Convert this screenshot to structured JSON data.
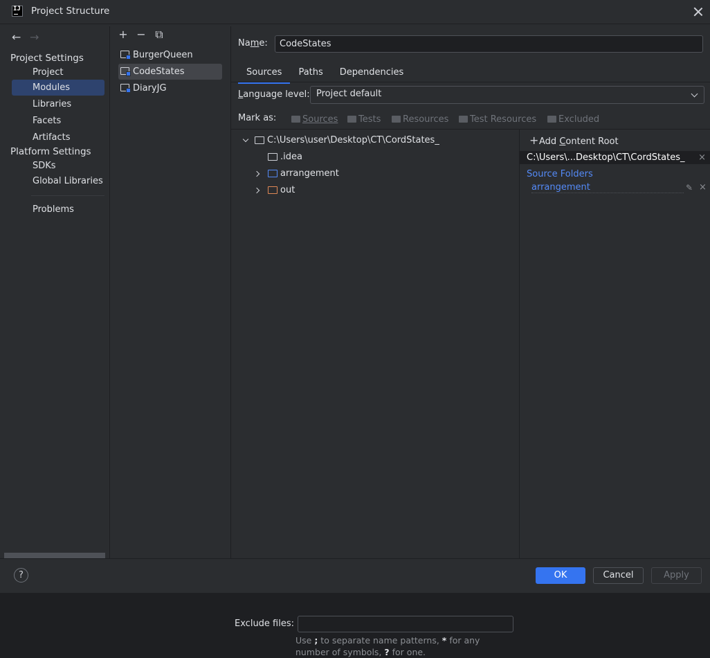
{
  "window": {
    "title": "Project Structure"
  },
  "nav": {
    "back_icon": "arrow-left-icon",
    "forward_icon": "arrow-right-icon",
    "project_settings_header": "Project Settings",
    "platform_settings_header": "Platform Settings",
    "project_items": [
      "Project",
      "Modules",
      "Libraries",
      "Facets",
      "Artifacts"
    ],
    "platform_items": [
      "SDKs",
      "Global Libraries"
    ],
    "problems": "Problems",
    "selected": "Modules"
  },
  "modules": {
    "toolbar_icons": [
      "plus-icon",
      "minus-icon",
      "copy-icon"
    ],
    "items": [
      "BurgerQueen",
      "CodeStates",
      "DiaryJG"
    ],
    "selected": "CodeStates"
  },
  "main": {
    "name_label_pre": "Na",
    "name_label_u": "m",
    "name_label_post": "e:",
    "name_value": "CodeStates",
    "tabs": [
      "Sources",
      "Paths",
      "Dependencies"
    ],
    "active_tab": "Sources",
    "language_level_label_u": "L",
    "language_level_label_rest": "anguage level:",
    "language_level_value": "Project default",
    "mark_as_label": "Mark as:",
    "mark_buttons": [
      "Sources",
      "Tests",
      "Resources",
      "Test Resources",
      "Excluded"
    ],
    "tree": {
      "root": "C:\\Users\\user\\Desktop\\CT\\CordStates_",
      "children": [
        ".idea",
        "arrangement",
        "out"
      ]
    },
    "content_root": {
      "add_label_pre": "Add ",
      "add_label_u": "C",
      "add_label_post": "ontent Root",
      "root_path": "C:\\Users\\...Desktop\\CT\\CordStates_",
      "source_folders_header": "Source Folders",
      "source_folders": [
        "arrangement"
      ]
    },
    "exclude_label": "Exclude files:",
    "exclude_value": "",
    "exclude_hint_1a": "Use ",
    "exclude_hint_1b": ";",
    "exclude_hint_1c": " to separate name patterns, ",
    "exclude_hint_1d": "*",
    "exclude_hint_1e": " for any",
    "exclude_hint_2a": "number of symbols, ",
    "exclude_hint_2b": "?",
    "exclude_hint_2c": " for one."
  },
  "footer": {
    "help": "?",
    "ok": "OK",
    "cancel": "Cancel",
    "apply": "Apply"
  },
  "colors": {
    "accent": "#3574f0",
    "selection": "#2e436e",
    "source_folder": "#548af7",
    "excluded_folder": "#e08855"
  }
}
